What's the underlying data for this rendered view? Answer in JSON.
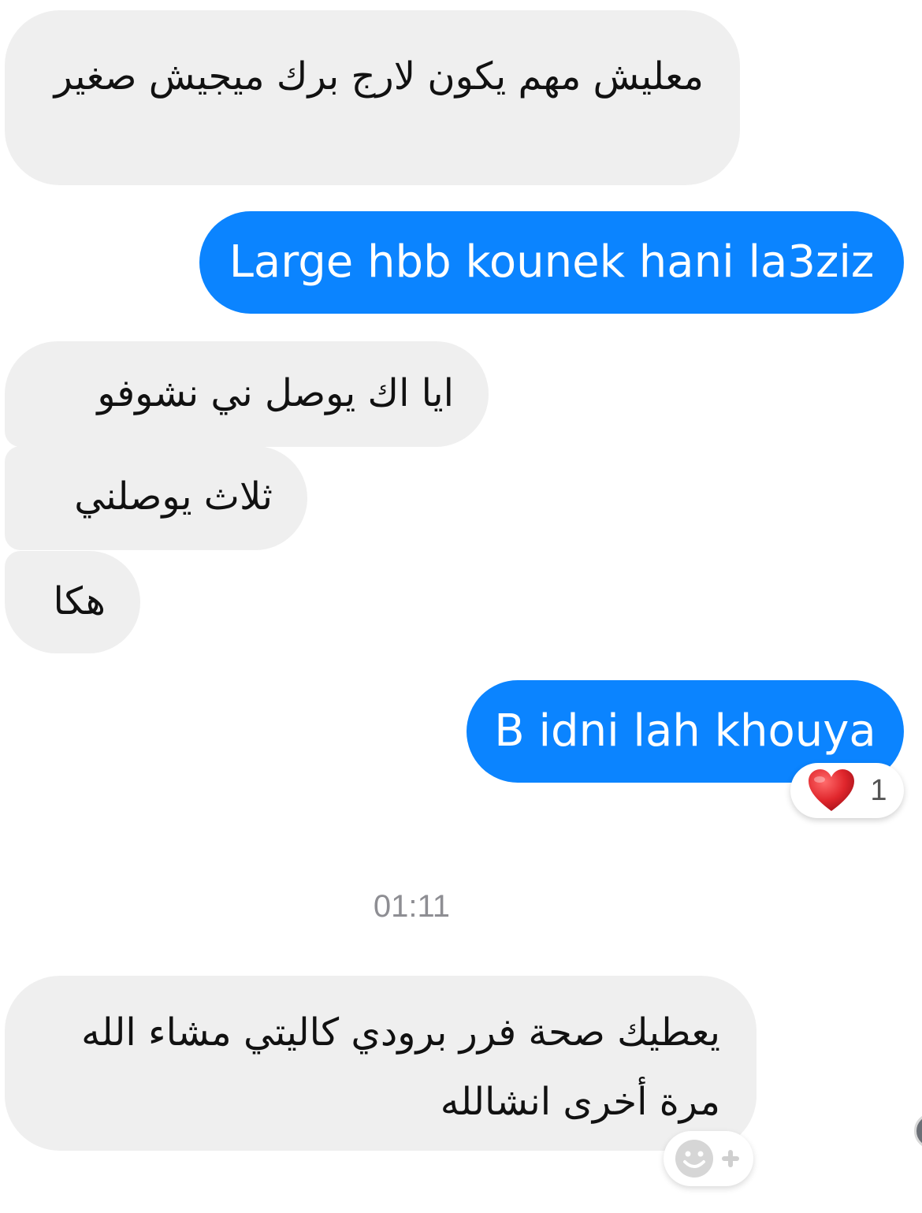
{
  "messages": {
    "m1": "معليش مهم يكون لارج برك ميجيش صغير",
    "m2": "Large hbb kounek hani la3ziz",
    "m3": "ايا اك يوصل ني نشوفو",
    "m4": "ثلاث يوصلني",
    "m5": "هكا",
    "m6": "B idni lah khouya",
    "m7": "يعطيك صحة فرر برودي كاليتي  مشاء الله  مرة أخرى انشالله"
  },
  "reaction": {
    "icon": "heart-icon",
    "count": "1"
  },
  "timestamp": "01:11",
  "add_reaction": {
    "icon": "smiley-plus-icon"
  },
  "colors": {
    "outgoing": "#0b84ff",
    "incoming": "#efefef",
    "heart": "#e0262c"
  }
}
